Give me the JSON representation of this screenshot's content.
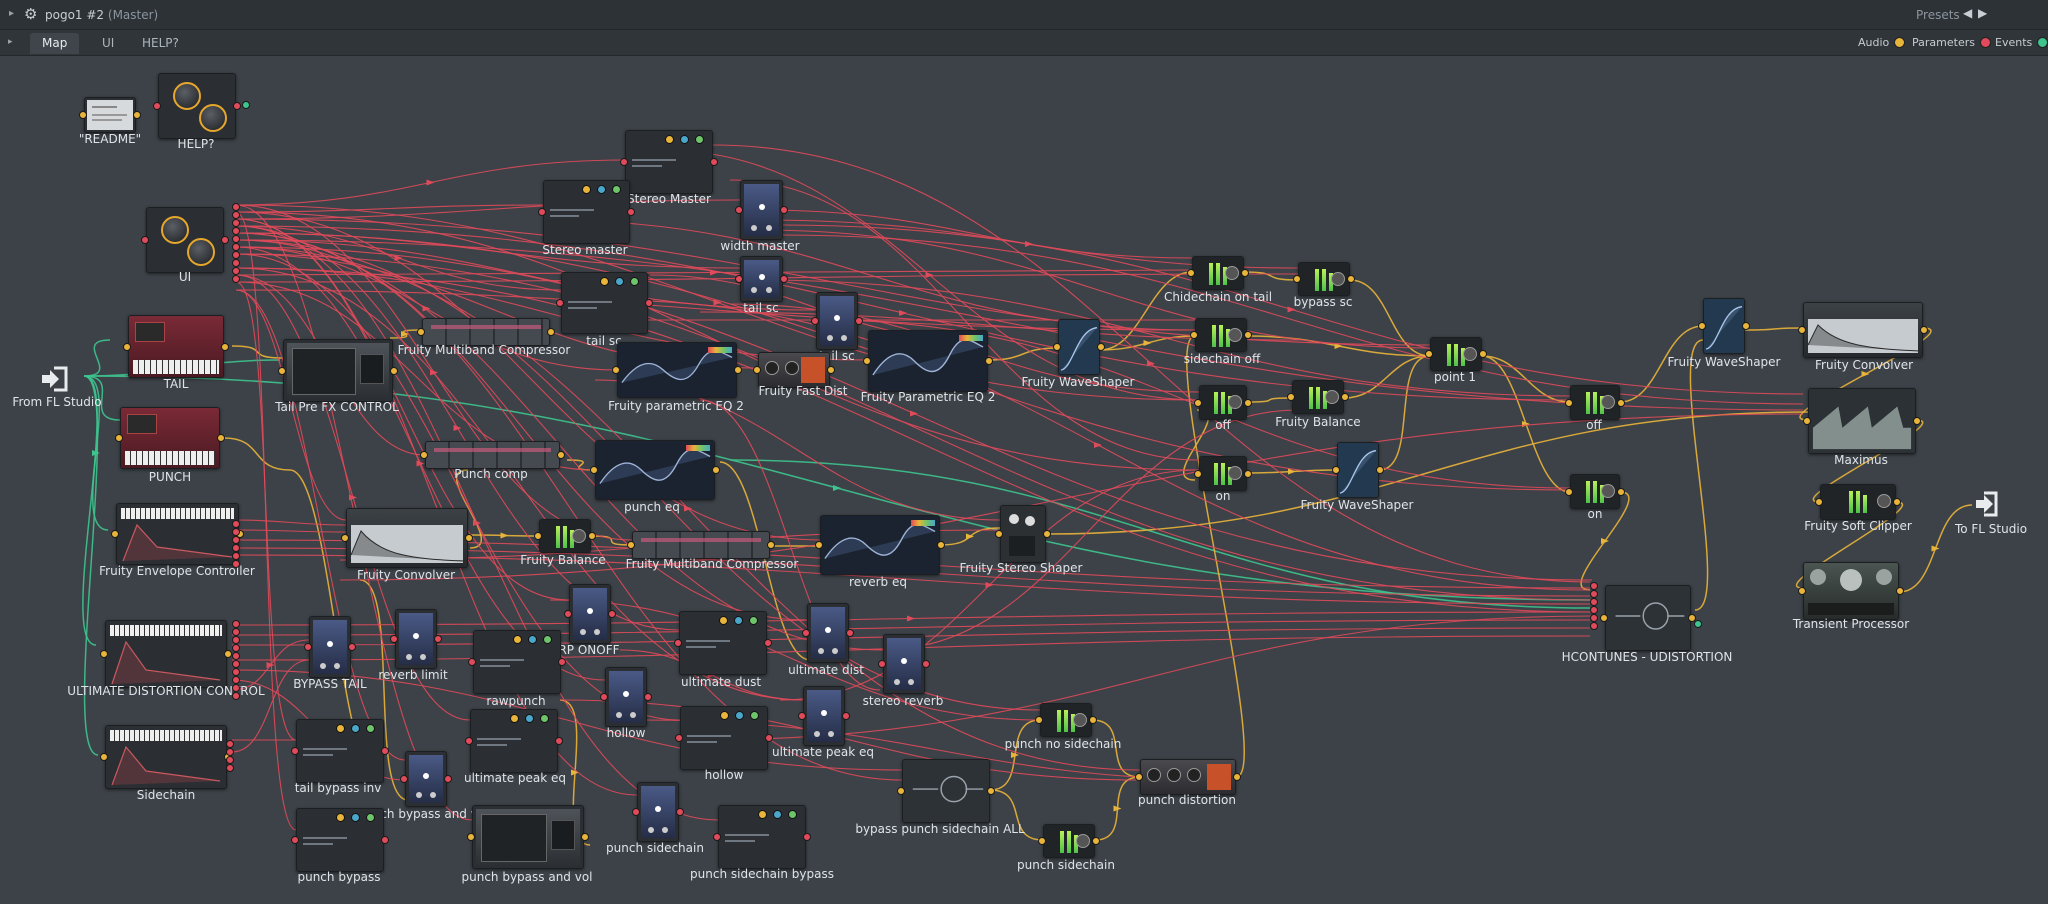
{
  "window": {
    "title": "pogo1 #2",
    "title_sub": "(Master)",
    "presets_label": "Presets",
    "prev_icon": "triangle-left",
    "next_icon": "triangle-right"
  },
  "tabs": [
    "Map",
    "UI",
    "HELP?"
  ],
  "toggles": [
    {
      "label": "Audio",
      "color": "#e9b43a"
    },
    {
      "label": "Parameters",
      "color": "#e04a5a"
    },
    {
      "label": "Events",
      "color": "#3ec48e"
    }
  ],
  "colors": {
    "audio": "#e9b43a",
    "param": "#e04a5a",
    "event": "#3ec48e",
    "background": "#3c4248"
  },
  "nodes": {
    "readme": "\"README\"",
    "help": "HELP?",
    "ui": "UI",
    "from_fl": "From FL Studio",
    "to_fl": "To FL Studio",
    "tail": "TAIL",
    "punch": "PUNCH",
    "env": "Fruity Envelope Controller",
    "udc": "ULTIMATE DISTORTION CONTROL",
    "sidechain": "Sidechain",
    "tail_pre": "Tail Pre FX CONTROL",
    "multiband1": "Fruity Multiband Compressor",
    "stereo_master_top": "Stereo Master",
    "stereo_master": "Stereo master",
    "width_master": "width master",
    "tail_sc1": "tail sc",
    "tail_sc2": "tail sc",
    "tail_sc3": "tail sc",
    "peq2": "Fruity parametric EQ 2",
    "fast_dist": "Fruity Fast Dist",
    "peq2b": "Fruity Parametric EQ 2",
    "waveshaper1": "Fruity WaveShaper",
    "chide": "Chidechain on tail",
    "bypass_sc": "bypass sc",
    "sidechain_off": "sidechain off",
    "off1": "off",
    "on1": "on",
    "balance1": "Fruity Balance",
    "waveshaper2": "Fruity WaveShaper",
    "point1": "point 1",
    "off2": "off",
    "on2": "on",
    "waveshaper3": "Fruity WaveShaper",
    "convolver_r": "Fruity Convolver",
    "maximus": "Maximus",
    "soft_clipper": "Fruity Soft Clipper",
    "transient": "Transient Processor",
    "punch_comp": "Punch comp",
    "punch_eq": "punch eq",
    "convolver": "Fruity Convolver",
    "balance2": "Fruity Balance",
    "multiband2": "Fruity Multiband Compressor",
    "reverb_eq": "reverb eq",
    "stereo_shaper": "Fruity Stereo Shaper",
    "hcontunes": "HCONTUNES - UDISTORTION",
    "bypass_tail": "BYPASS TAIL",
    "reverb_limit": "reverb limit",
    "rp_onoff": "RP ONOFF",
    "rawpunch": "rawpunch",
    "ultimate_dust": "ultimate dust",
    "ultimate_dist": "ultimate dist",
    "stereo_reverb": "stereo reverb",
    "hollow1": "hollow",
    "hollow2": "hollow",
    "ultimate_peak_eq1": "ultimate peak eq",
    "ultimate_peak_eq2": "ultimate peak eq",
    "tail_bypass_inv": "tail bypass inv",
    "punch_bypass_vol1": "punch bypass and vol",
    "punch_bypass_vol2": "punch bypass and vol",
    "punch_bypass": "punch bypass",
    "punch_sidechain1": "punch sidechain",
    "punch_sidechain_bypass": "punch sidechain bypass",
    "bypass_punch_all": "bypass punch sidechain ALL",
    "punch_no_sc": "punch no sidechain",
    "punch_distortion": "punch distortion",
    "punch_sidechain2": "punch sidechain"
  }
}
